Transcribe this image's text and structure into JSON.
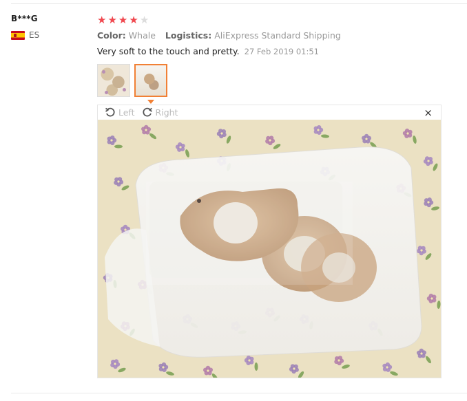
{
  "reviewer": {
    "name": "B***G",
    "country_code": "ES"
  },
  "rating": {
    "value": 4,
    "max": 5
  },
  "meta": {
    "color_label": "Color:",
    "color_value": "Whale",
    "logistics_label": "Logistics:",
    "logistics_value": "AliExpress Standard Shipping"
  },
  "review": {
    "text": "Very soft to the touch and pretty.",
    "date": "27 Feb 2019 01:51"
  },
  "thumbnails": [
    {
      "active": false
    },
    {
      "active": true
    }
  ],
  "viewer": {
    "rotate_left_label": "Left",
    "rotate_right_label": "Right",
    "close_icon": "×"
  },
  "colors": {
    "accent": "#f18035",
    "star": "#f0484f",
    "star_off": "#dcdcdc"
  }
}
